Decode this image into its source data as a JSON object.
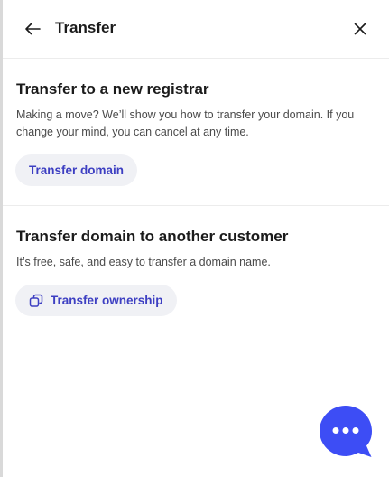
{
  "header": {
    "title": "Transfer",
    "back_icon": "arrow-left-icon",
    "close_icon": "close-icon"
  },
  "registrar": {
    "title": "Transfer to a new registrar",
    "description": "Making a move? We’ll show you how to transfer your domain. If you change your mind, you can cancel at any time.",
    "button_label": "Transfer domain"
  },
  "customer": {
    "title": "Transfer domain to another customer",
    "description": "It’s free, safe, and easy to transfer a domain name.",
    "button_label": "Transfer ownership",
    "button_icon": "swap-icon"
  },
  "chat": {
    "icon": "chat-bubble-icon"
  },
  "colors": {
    "accent": "#3d3fc2",
    "chat_blue": "#3d4df5",
    "pill_bg": "#f0f1f5"
  }
}
